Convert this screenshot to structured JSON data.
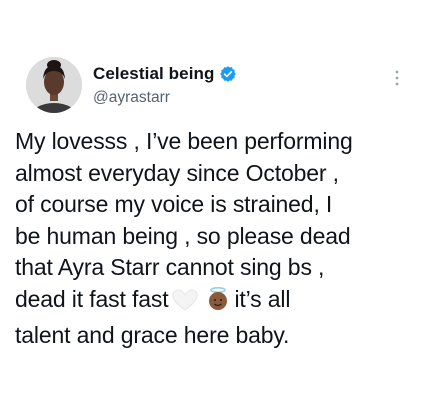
{
  "author": {
    "display_name": "Celestial being",
    "handle": "@ayrastarr",
    "verified_color": "#1d9bf0"
  },
  "icons": {
    "verified": "verified-badge-icon",
    "more": "more-options-icon",
    "emoji_1": "white-heart-emoji",
    "emoji_2": "angel-face-emoji"
  },
  "tweet": {
    "lines": [
      "My lovesss , I’ve been performing",
      "almost everyday since October ,",
      "of course my voice is strained, I",
      "be human being , so please dead",
      "that Ayra Starr cannot sing bs ,",
      "dead it fast fast",
      "it’s all",
      "talent and grace here baby."
    ]
  }
}
